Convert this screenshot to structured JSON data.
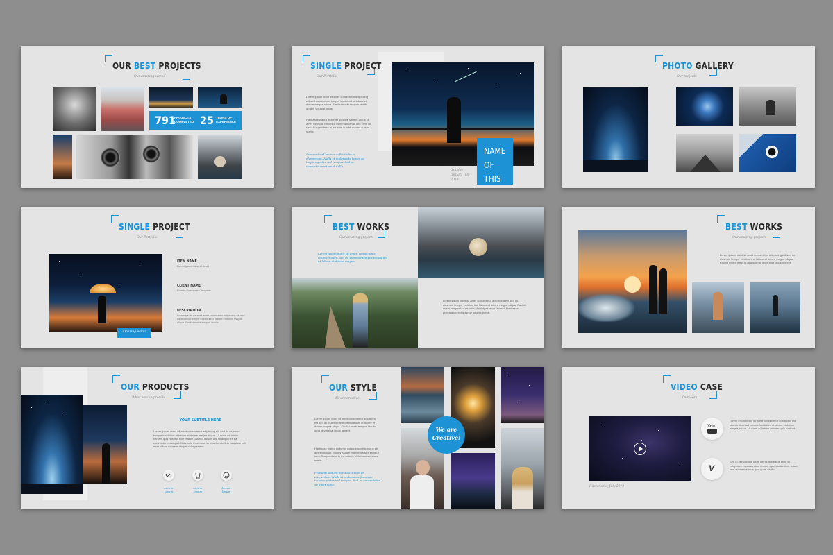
{
  "slides": {
    "s1": {
      "title_a": "OUR ",
      "title_b": "BEST",
      "title_c": " PROJECTS",
      "subtitle": "Our amazing works",
      "stat1_value": "791",
      "stat1_label": "PROJECTS COMPLETED",
      "stat2_value": "25",
      "stat2_label": "YEARS OF EXPERIENCE"
    },
    "s2": {
      "title_a": "SINGLE",
      "title_b": " PROJECT",
      "subtitle": "Our Portfolio",
      "body1": "Lorem ipsum dolor sit amet consectetur adipiscing elit sed do eiusmod tempor incididunt ut labore et dolore magna aliqua. Facilisi morbi tempus iaculis urna id volutpat lacus.",
      "body2": "Habitasse platea dictumst quisque sagittis purus sit amet volutpat. Mauris a diam maecenas sed enim ut sem. Suspendisse in est ante in nibh mauris cursus mattis.",
      "italic": "Praesent sed leo nec sollicitudin et elementum. Nulla et malesuada fames ac turpis egestas sed tempus. Sed ac consectetur sit amet nulla.",
      "caption": "Graphic Design, July 2019",
      "badge": "NAME OF THIS WORK"
    },
    "s3": {
      "title_a": "PHOTO",
      "title_b": " GALLERY",
      "subtitle": "Our projects"
    },
    "s4": {
      "title_a": "SINGLE",
      "title_b": " PROJECT",
      "subtitle": "Our Portfolio",
      "item_label": "ITEM NAME",
      "item_value": "Lorem ipsum dolor sit amet",
      "client_label": "CLIENT NAME",
      "client_value": "Duarda Powerpoint Template",
      "desc_label": "DESCRIPTION",
      "desc_value": "Lorem ipsum dolor sit amet consectetur adipiscing elit sed do eiusmod tempor incididunt ut labore et dolore magna aliqua. Facilisi morbi tempus iaculis.",
      "button": "Amazing work!"
    },
    "s5": {
      "title_a": "BEST",
      "title_b": " WORKS",
      "subtitle": "Our amazing projects",
      "italic": "Lorem ipsum dolor sit amet, consectetur adipiscing elit, sed do eiusmod tempor incididunt ut labore et dolore magna.",
      "body": "Lorem ipsum dolor sit amet consectetur adipiscing elit sed do eiusmod tempor incididunt ut labore et dolore magna aliqua. Facilisi morbi tempus iaculis urna id volutpat lacus laoreet. Habitasse platea dictumst quisque sagittis purus."
    },
    "s6": {
      "title_a": "BEST",
      "title_b": " WORKS",
      "subtitle": "Our amazing projects",
      "body": "Lorem ipsum dolor sit amet consectetur adipiscing elit sed do eiusmod tempor incididunt ut labore et dolore magna aliqua. Facilisi morbi tempus iaculis urna id volutpat lacus laoreet."
    },
    "s7": {
      "title_a": "OUR",
      "title_b": " PRODUCTS",
      "subtitle": "What we can provide",
      "section": "YOUR SUBTITLE HERE",
      "body": "Lorem ipsum dolor sit amet consectetur adipiscing elit sed do eiusmod tempor incididunt ut labore et dolore magna aliqua. Ut enim ad minim veniam quis nostrud exercitation ullamco laboris nisi ut aliquip ex ea commodo consequat. Duis aute irure dolor in reprehenderit in voluptate velit esse cillum dolore eu fugiat nulla pariatur.",
      "icon1": "Lorem Ipsum",
      "icon2": "Lorem Ipsum",
      "icon3": "Lorem Ipsum"
    },
    "s8": {
      "title_a": "OUR",
      "title_b": " STYLE",
      "subtitle": "We are creative",
      "body1": "Lorem ipsum dolor sit amet consectetur adipiscing elit sed do eiusmod tempor incididunt ut labore et dolore magna aliqua. Facilisi morbi tempus iaculis urna id volutpat lacus laoreet.",
      "body2": "Habitasse platea dictumst quisque sagittis purus sit amet volutpat. Mauris a diam maecenas sed enim ut sem. Suspendisse in est ante in nibh mauris cursus mattis.",
      "italic": "Praesent sed leo nec sollicitudin et elementum. Nulla et malesuada fames ac turpis egestas sed tempus. Sed ac consectetur sit amet nulla.",
      "circle": "We are Creative!"
    },
    "s9": {
      "title_a": "VIDEO",
      "title_b": " CASE",
      "subtitle": "Our work",
      "yt_text": "Lorem ipsum dolor sit amet consectetur adipiscing elit sed do eiusmod tempor incididunt ut labore et dolore magna aliqua. Ut enim ad minim veniam quis nostrud.",
      "vm_text": "Sed ut perspiciatis unde omnis iste natus error sit voluptatem accusantium doloremque laudantium, totam rem aperiam eaque ipsa quae ab illo.",
      "caption": "Video name, July 2019"
    }
  },
  "colors": {
    "accent": "#1d92d5",
    "slide_bg": "#e4e4e4",
    "page_bg": "#8e8e8e"
  }
}
